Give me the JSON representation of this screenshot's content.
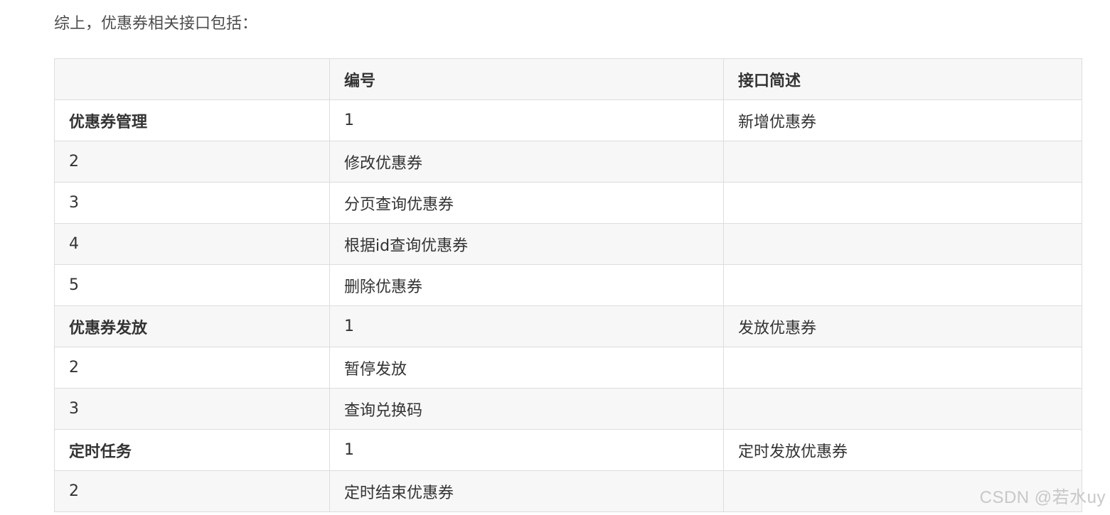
{
  "intro_text": "综上，优惠券相关接口包括：",
  "table": {
    "headers": [
      "",
      "编号",
      "接口简述"
    ],
    "rows": [
      [
        "优惠券管理",
        "1",
        "新增优惠券"
      ],
      [
        "2",
        "修改优惠券",
        ""
      ],
      [
        "3",
        "分页查询优惠券",
        ""
      ],
      [
        "4",
        "根据id查询优惠券",
        ""
      ],
      [
        "5",
        "删除优惠券",
        ""
      ],
      [
        "优惠券发放",
        "1",
        "发放优惠券"
      ],
      [
        "2",
        "暂停发放",
        ""
      ],
      [
        "3",
        "查询兑换码",
        ""
      ],
      [
        "定时任务",
        "1",
        "定时发放优惠券"
      ],
      [
        "2",
        "定时结束优惠券",
        ""
      ]
    ]
  },
  "watermark": "CSDN @若水uy"
}
